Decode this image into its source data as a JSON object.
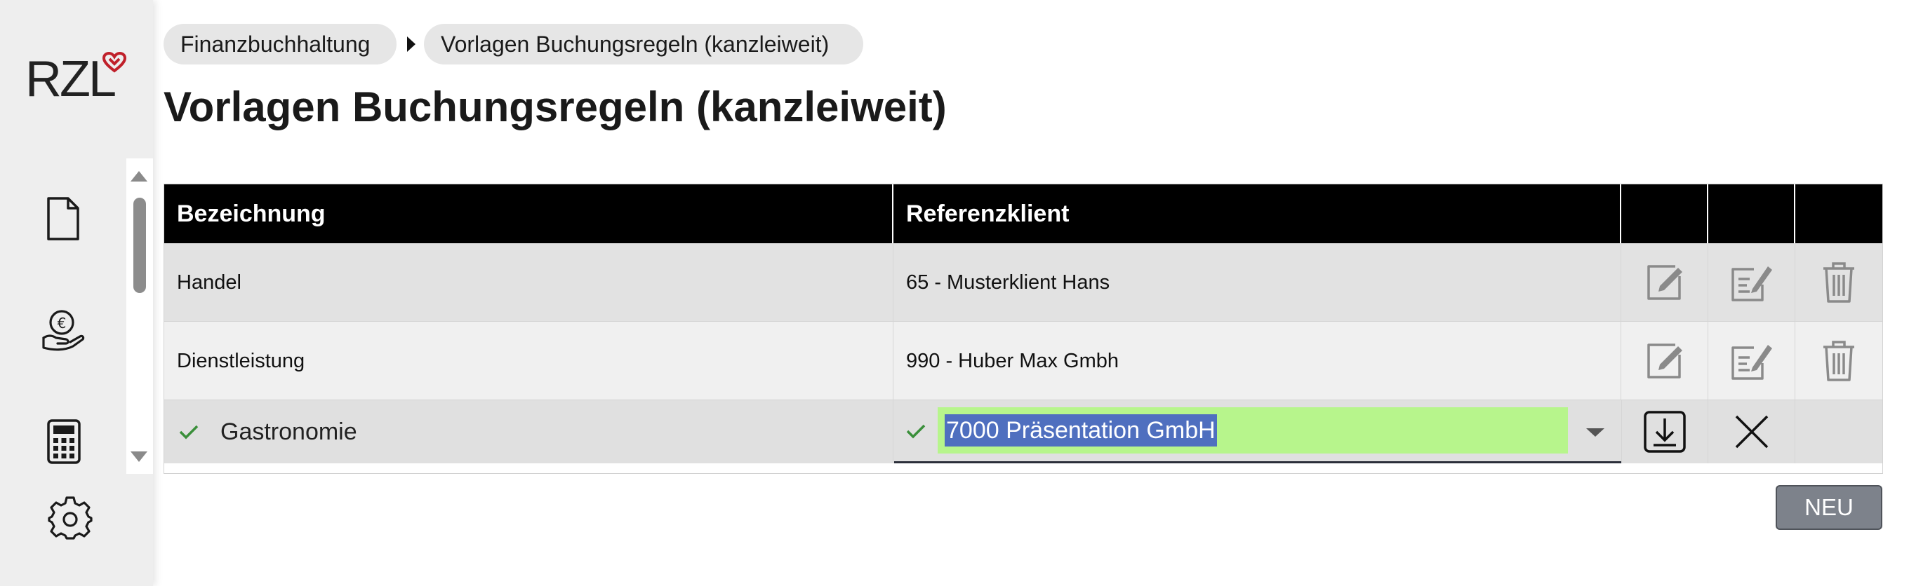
{
  "app": {
    "logo_text": "RZL",
    "colors": {
      "brand_red": "#c0202a",
      "accent_green": "#b7f58c",
      "selection_blue": "#4f6fbf",
      "check_green": "#3a8f3a"
    }
  },
  "sidebar": {
    "items": [
      {
        "icon": "document-icon"
      },
      {
        "icon": "euro-hand-icon"
      },
      {
        "icon": "calculator-icon"
      },
      {
        "icon": "gear-icon"
      }
    ]
  },
  "breadcrumb": {
    "items": [
      {
        "label": "Finanzbuchhaltung"
      },
      {
        "label": "Vorlagen Buchungsregeln (kanzleiweit)"
      }
    ]
  },
  "page": {
    "title": "Vorlagen Buchungsregeln (kanzleiweit)"
  },
  "table": {
    "columns": [
      {
        "label": "Bezeichnung"
      },
      {
        "label": "Referenzklient"
      },
      {
        "label": ""
      },
      {
        "label": ""
      },
      {
        "label": ""
      }
    ],
    "rows": [
      {
        "bezeichnung": "Handel",
        "referenzklient": "65 - Musterklient Hans"
      },
      {
        "bezeichnung": "Dienstleistung",
        "referenzklient": "990 - Huber Max Gmbh"
      }
    ],
    "edit_row": {
      "bezeichnung": "Gastronomie",
      "referenzklient_value": "7000 Präsentation GmbH"
    }
  },
  "actions": {
    "new_label": "NEU"
  }
}
